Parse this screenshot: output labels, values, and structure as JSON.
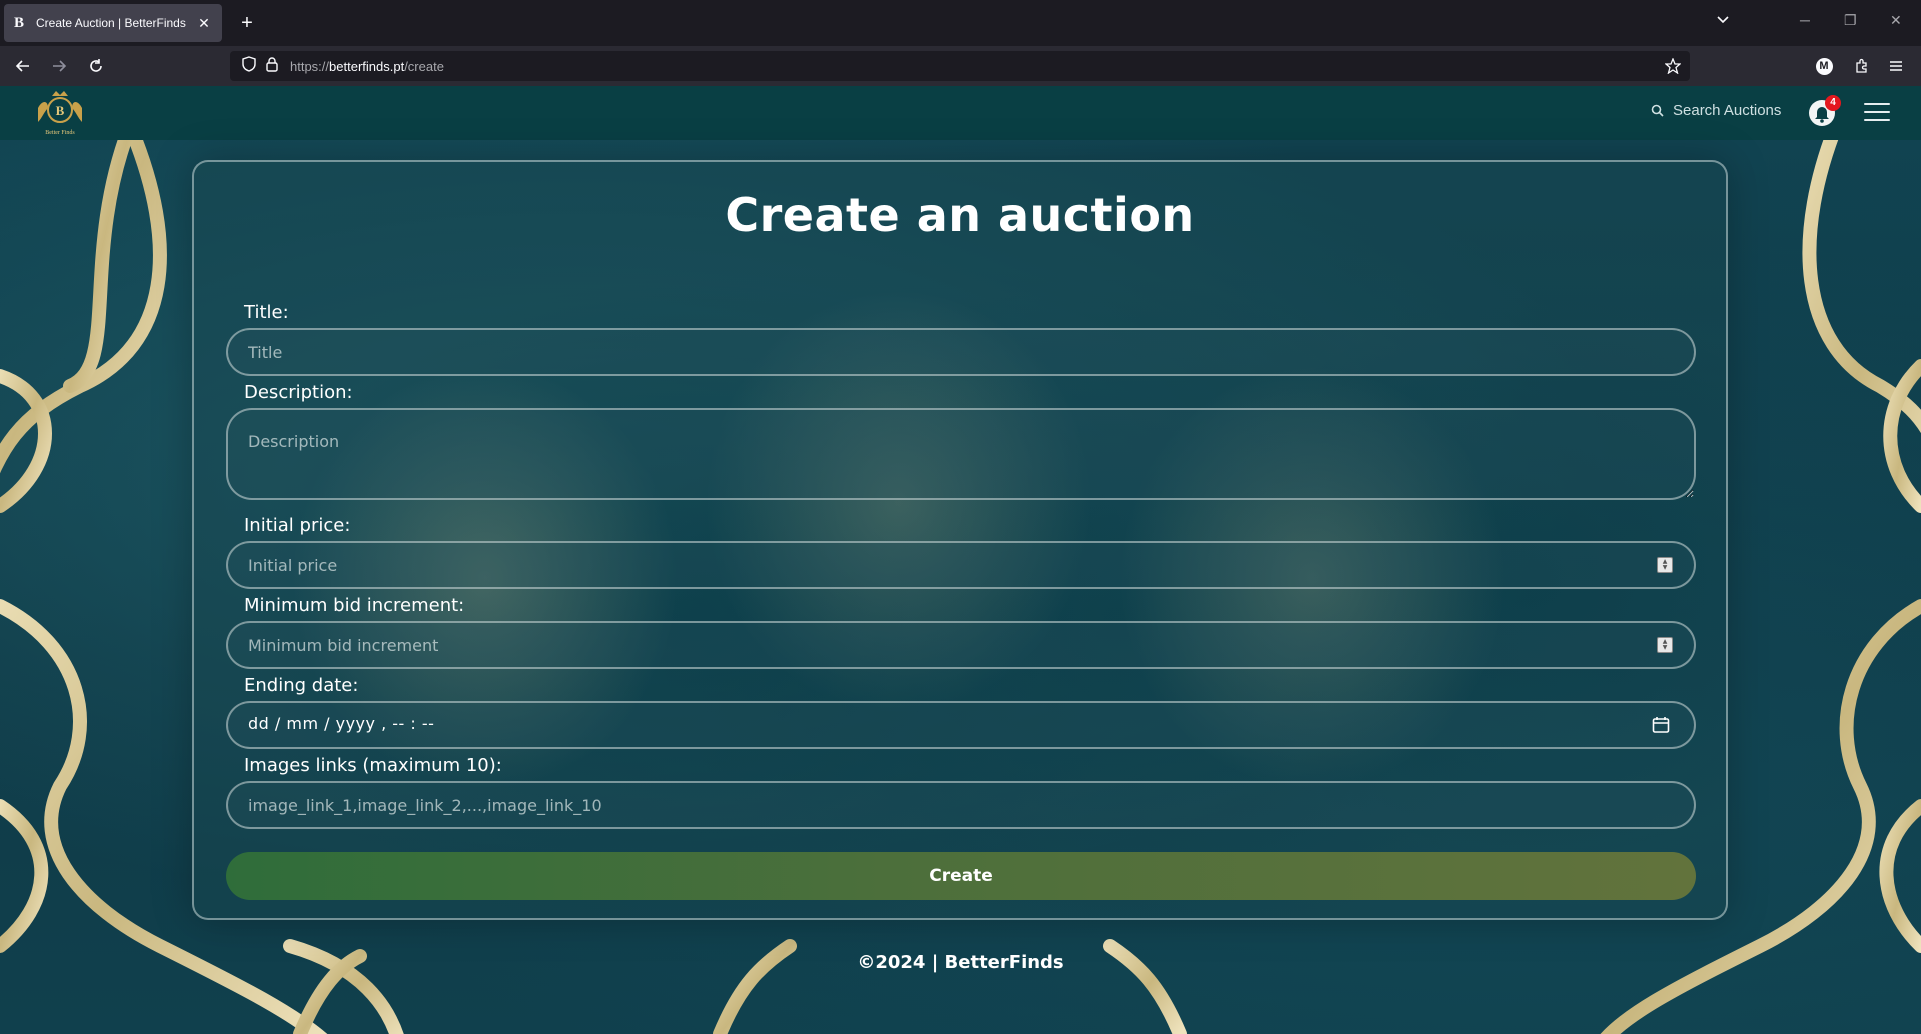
{
  "browser": {
    "tab_title": "Create Auction | BetterFinds",
    "tab_favicon": "B",
    "new_tab_label": "+",
    "url_prefix": "https://",
    "url_host": "betterfinds.pt",
    "url_path": "/create",
    "profile_initial": "M"
  },
  "site": {
    "logo_text": "Better Finds",
    "logo_letter": "B",
    "search_label": "Search Auctions",
    "notification_count": "4"
  },
  "form": {
    "heading": "Create an auction",
    "title_label": "Title:",
    "title_placeholder": "Title",
    "description_label": "Description:",
    "description_placeholder": "Description",
    "initial_price_label": "Initial price:",
    "initial_price_placeholder": "Initial price",
    "min_bid_label": "Minimum bid increment:",
    "min_bid_placeholder": "Minimum bid increment",
    "ending_date_label": "Ending date:",
    "ending_date_value": "dd / mm / yyyy ,  -- : --",
    "images_label": "Images links (maximum 10):",
    "images_placeholder": "image_link_1,image_link_2,...,image_link_10",
    "submit_label": "Create"
  },
  "footer": {
    "text": "©2024 | BetterFinds"
  },
  "colors": {
    "header": "#093f44",
    "button_start": "#2f6d3a",
    "button_end": "#62733c",
    "badge": "#e4181e"
  }
}
